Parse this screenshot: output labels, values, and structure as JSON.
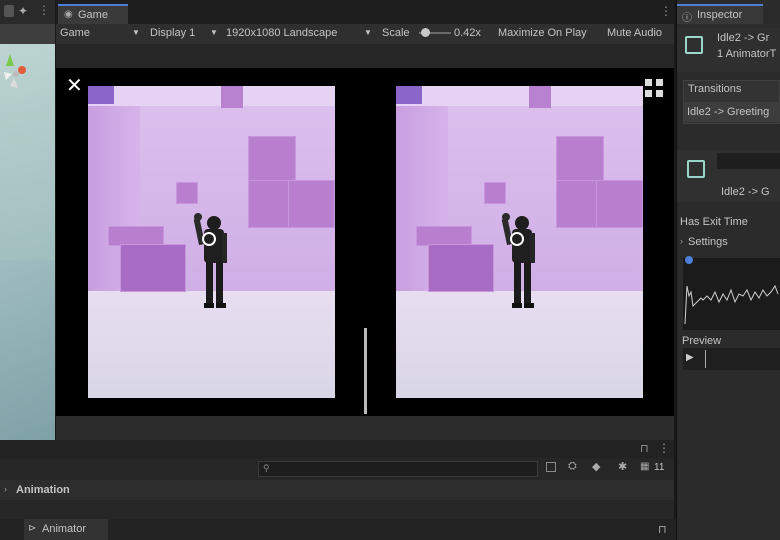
{
  "game": {
    "tab_label": "Game",
    "view_mode": "Game",
    "display": "Display 1",
    "resolution": "1920x1080 Landscape",
    "scale_label": "Scale",
    "scale_value": "0.42x",
    "maximize_label": "Maximize On Play",
    "mute_label": "Mute Audio",
    "scale_level": 0.1
  },
  "inspector": {
    "tab_label": "Inspector",
    "title_line1": "Idle2 -> Gr",
    "title_line2": "1 AnimatorT",
    "transitions_label": "Transitions",
    "transition_item": "Idle2 -> Greeting",
    "object_label": "Idle2 -> G",
    "has_exit_time": "Has Exit Time",
    "settings_label": "Settings",
    "preview_label": "Preview"
  },
  "bottom": {
    "animation_label": "Animation",
    "animator_label": "Animator",
    "layer_count": "11"
  },
  "colors": {
    "accent": "#4c7fd6",
    "room_tint": "#d7b6e8"
  }
}
